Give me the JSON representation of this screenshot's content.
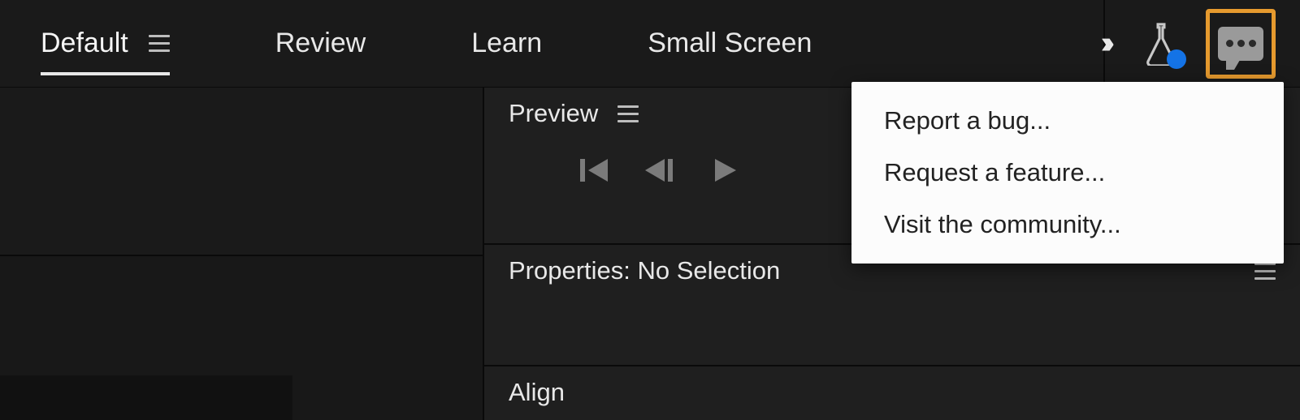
{
  "workspace": {
    "tabs": [
      {
        "label": "Default",
        "active": true,
        "hasMenu": true
      },
      {
        "label": "Review",
        "active": false,
        "hasMenu": false
      },
      {
        "label": "Learn",
        "active": false,
        "hasMenu": false
      },
      {
        "label": "Small Screen",
        "active": false,
        "hasMenu": false
      }
    ]
  },
  "toolbar": {
    "feedback_highlight_color": "#e69a2e",
    "beta_dot_color": "#1473e6"
  },
  "panels": {
    "preview": {
      "title": "Preview"
    },
    "properties": {
      "title": "Properties: No Selection"
    },
    "align": {
      "title": "Align"
    }
  },
  "feedback_menu": {
    "items": [
      "Report a bug...",
      "Request a feature...",
      "Visit the community..."
    ]
  }
}
